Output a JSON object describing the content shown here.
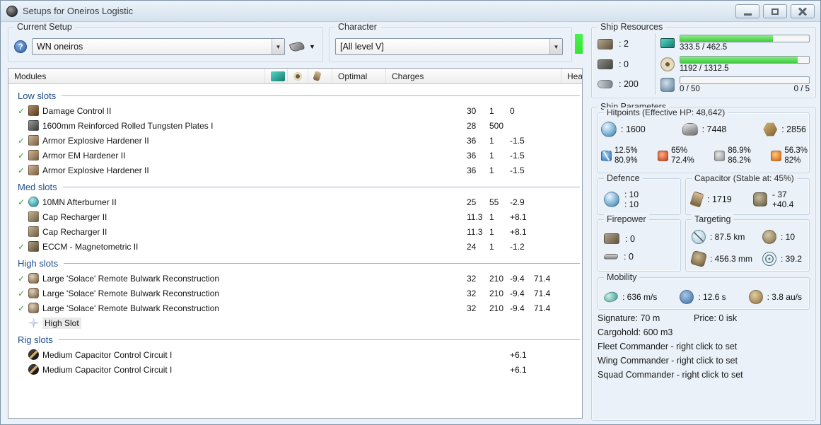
{
  "window": {
    "title": "Setups for Oneiros Logistic"
  },
  "toolbar": {
    "current_setup": {
      "label": "Current Setup",
      "value": "WN oneiros"
    },
    "character": {
      "label": "Character",
      "value": "[All level V]"
    }
  },
  "modules_table": {
    "headers": {
      "modules": "Modules",
      "optimal": "Optimal",
      "charges": "Charges",
      "heat": "Hea"
    },
    "sections": [
      {
        "name": "Low slots",
        "rows": [
          {
            "active": true,
            "icon": "mod-damage-control",
            "name": "Damage Control II",
            "cpu": "30",
            "pg": "1",
            "cap": "0"
          },
          {
            "active": false,
            "icon": "mod-armor-plate",
            "name": "1600mm Reinforced Rolled Tungsten Plates I",
            "cpu": "28",
            "pg": "500"
          },
          {
            "active": true,
            "icon": "mod-hardener",
            "name": "Armor Explosive Hardener II",
            "cpu": "36",
            "pg": "1",
            "cap": "-1.5"
          },
          {
            "active": true,
            "icon": "mod-hardener",
            "name": "Armor EM Hardener II",
            "cpu": "36",
            "pg": "1",
            "cap": "-1.5"
          },
          {
            "active": true,
            "icon": "mod-hardener",
            "name": "Armor Explosive Hardener II",
            "cpu": "36",
            "pg": "1",
            "cap": "-1.5"
          }
        ]
      },
      {
        "name": "Med slots",
        "rows": [
          {
            "active": true,
            "icon": "mod-afterburner",
            "name": "10MN Afterburner II",
            "cpu": "25",
            "pg": "55",
            "cap": "-2.9"
          },
          {
            "active": false,
            "icon": "mod-cap-recharger",
            "name": "Cap Recharger II",
            "cpu": "11.3",
            "pg": "1",
            "cap": "+8.1"
          },
          {
            "active": false,
            "icon": "mod-cap-recharger",
            "name": "Cap Recharger II",
            "cpu": "11.3",
            "pg": "1",
            "cap": "+8.1"
          },
          {
            "active": true,
            "icon": "mod-eccm",
            "name": "ECCM - Magnetometric II",
            "cpu": "24",
            "pg": "1",
            "cap": "-1.2"
          }
        ]
      },
      {
        "name": "High slots",
        "rows": [
          {
            "active": true,
            "icon": "mod-remote-rep",
            "name": "Large 'Solace' Remote Bulwark Reconstruction",
            "cpu": "32",
            "pg": "210",
            "cap": "-9.4",
            "optimal": "71.4"
          },
          {
            "active": true,
            "icon": "mod-remote-rep",
            "name": "Large 'Solace' Remote Bulwark Reconstruction",
            "cpu": "32",
            "pg": "210",
            "cap": "-9.4",
            "optimal": "71.4"
          },
          {
            "active": true,
            "icon": "mod-remote-rep",
            "name": "Large 'Solace' Remote Bulwark Reconstruction",
            "cpu": "32",
            "pg": "210",
            "cap": "-9.4",
            "optimal": "71.4"
          },
          {
            "active": false,
            "icon": "mod-empty-high",
            "name": "High Slot",
            "empty": true
          }
        ]
      },
      {
        "name": "Rig slots",
        "rows": [
          {
            "active": false,
            "icon": "mod-rig",
            "name": "Medium Capacitor Control Circuit I",
            "cap": "+6.1"
          },
          {
            "active": false,
            "icon": "mod-rig",
            "name": "Medium Capacitor Control Circuit I",
            "cap": "+6.1"
          }
        ]
      }
    ]
  },
  "ship_resources": {
    "label": "Ship Resources",
    "stats": [
      {
        "icon": "turret-hardpoints-icon",
        "cls": "ic-turret",
        "value": ": 2"
      },
      {
        "icon": "launcher-hardpoints-icon",
        "cls": "ic-launcher",
        "value": ": 0"
      },
      {
        "icon": "calibration-icon",
        "cls": "ic-calibration",
        "value": ": 200"
      }
    ],
    "bars": [
      {
        "icon": "cpu-icon",
        "cls": "ic-cpu",
        "pct": 72,
        "text": "333.5 / 462.5"
      },
      {
        "icon": "powergrid-icon",
        "cls": "ic-pg",
        "pct": 91,
        "text": "1192 / 1312.5"
      },
      {
        "icon": "dronebay-icon",
        "cls": "ic-drone",
        "pct": 0,
        "text": "0 / 50",
        "text_right": "0 / 5"
      }
    ]
  },
  "ship_parameters": {
    "label": "Ship Parameters",
    "hitpoints": {
      "label": "Hitpoints (Effective HP: 48,642)",
      "values": [
        {
          "icon": "shield-hp-icon",
          "cls": "ic-shield",
          "value": ": 1600"
        },
        {
          "icon": "armor-hp-icon",
          "cls": "ic-armor",
          "value": ": 7448"
        },
        {
          "icon": "structure-hp-icon",
          "cls": "ic-structure",
          "value": ": 2856"
        }
      ],
      "resists": [
        {
          "type": "em",
          "shield": "12.5%",
          "armor": "80.9%"
        },
        {
          "type": "thermal",
          "shield": "65%",
          "armor": "72.4%"
        },
        {
          "type": "kinetic",
          "shield": "86.9%",
          "armor": "86.2%"
        },
        {
          "type": "explosive",
          "shield": "56.3%",
          "armor": "82%"
        }
      ]
    },
    "defence": {
      "label": "Defence",
      "line1": ": 10",
      "line2": ": 10"
    },
    "capacitor": {
      "label": "Capacitor (Stable at: 45%)",
      "amount": ": 1719",
      "delta_out": "- 37",
      "delta_in": "+40.4"
    },
    "firepower": {
      "label": "Firepower",
      "turret": ": 0",
      "missile": ": 0"
    },
    "targeting": {
      "label": "Targeting",
      "range": ": 87.5 km",
      "max_targets": ": 10",
      "scan_res": ": 456.3 mm",
      "sensor_strength": ": 39.2"
    },
    "mobility": {
      "label": "Mobility",
      "speed": ": 636 m/s",
      "align_time": ": 12.6 s",
      "warp_speed": ": 3.8 au/s"
    },
    "footer": {
      "signature": "Signature: 70 m",
      "price": "Price: 0 isk",
      "cargohold": "Cargohold: 600 m3",
      "fleet_commander": "Fleet Commander - right click to set",
      "wing_commander": "Wing Commander - right click to set",
      "squad_commander": "Squad Commander - right click to set"
    }
  },
  "colors": {
    "section_header_blue": "#1C4C8C",
    "check_green": "#35A535",
    "bar_fill_green": "#3FCB3F",
    "character_status_green": "#33E633"
  }
}
